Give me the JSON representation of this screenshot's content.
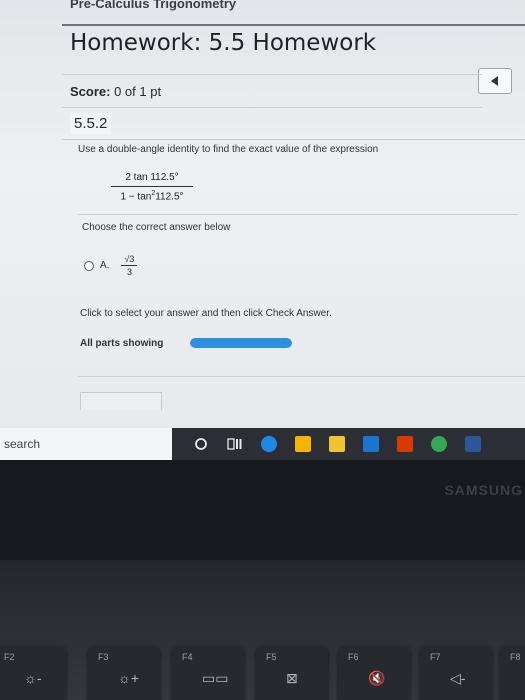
{
  "page": {
    "course_title": "Pre-Calculus Trigonometry",
    "homework_title": "Homework: 5.5 Homework",
    "score_label": "Score:",
    "score_value": "0 of 1 pt",
    "question_number": "5.5.2"
  },
  "question": {
    "instruction": "Use a double-angle identity to find the exact value of the expression",
    "numerator": "2 tan 112.5°",
    "denominator_prefix": "1 − tan",
    "denominator_exp": "2",
    "denominator_suffix": "112.5°",
    "choose_text": "Choose the correct answer below",
    "options": [
      {
        "letter": "A.",
        "numerator": "√3",
        "denominator": "3"
      }
    ],
    "click_message": "Click to select your answer and then click Check Answer.",
    "all_parts_label": "All parts showing",
    "progress_fraction": 1.0
  },
  "taskbar": {
    "search_placeholder": "search",
    "icons": [
      "cortana-icon",
      "task-view-icon",
      "edge-icon",
      "store-icon",
      "file-explorer-icon",
      "mail-icon",
      "office-icon",
      "chrome-icon",
      "word-icon"
    ],
    "colors": {
      "edge": "#1e88e5",
      "store": "#f5b400",
      "explorer": "#f3c233",
      "mail": "#1976d2",
      "office": "#d83b01",
      "chrome": "#34a853",
      "word": "#2b579a"
    }
  },
  "hardware": {
    "brand": "SAMSUNG",
    "fkeys": [
      {
        "label": "F2",
        "icon": "brightness-down-icon",
        "glyph": "☼-"
      },
      {
        "label": "F3",
        "icon": "brightness-up-icon",
        "glyph": "☼+"
      },
      {
        "label": "F4",
        "icon": "display-switch-icon",
        "glyph": "▭▭"
      },
      {
        "label": "F5",
        "icon": "touchpad-off-icon",
        "glyph": "⊠"
      },
      {
        "label": "F6",
        "icon": "mute-icon",
        "glyph": "🔇"
      },
      {
        "label": "F7",
        "icon": "volume-down-icon",
        "glyph": "◁-"
      },
      {
        "label": "F8",
        "icon": "volume-up-icon",
        "glyph": ""
      }
    ]
  }
}
